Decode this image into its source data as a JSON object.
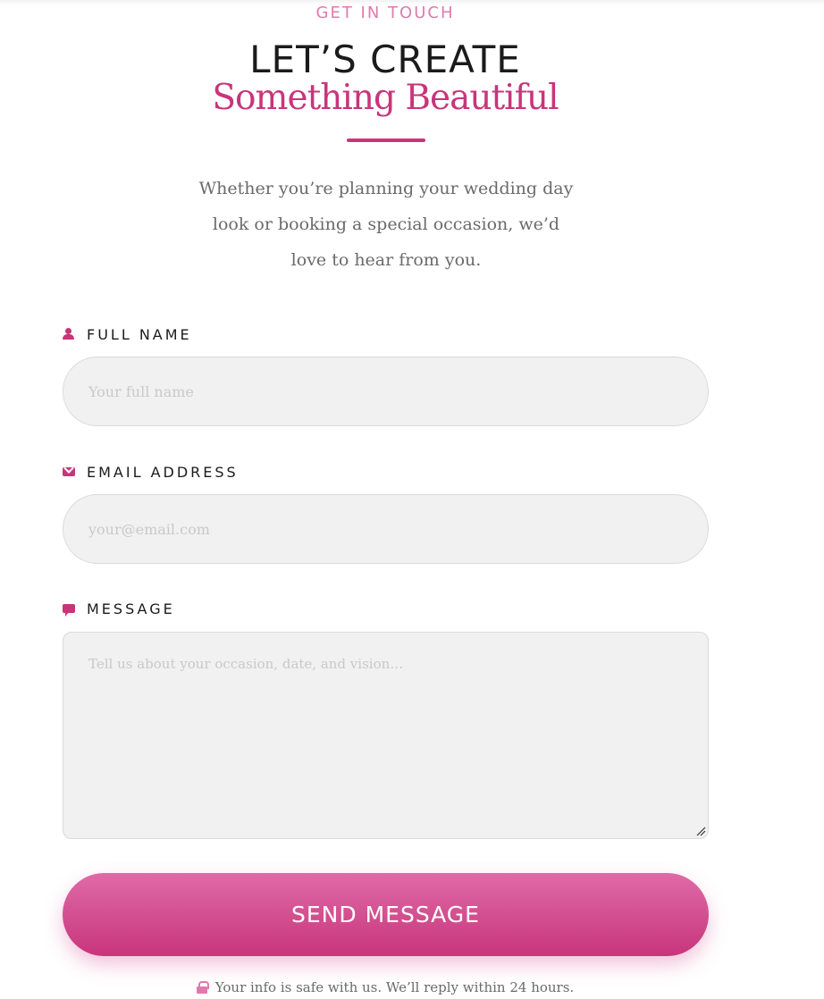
{
  "header": {
    "eyebrow": "GET IN TOUCH",
    "headline": "LET’S CREATE",
    "headline_script": "Something Beautiful",
    "intro": "Whether you’re planning your wedding day look or booking a special occasion, we’d love to hear from you."
  },
  "form": {
    "name": {
      "label": "FULL NAME",
      "icon": "user-icon",
      "value": "",
      "placeholder": "Your full name"
    },
    "email": {
      "label": "EMAIL ADDRESS",
      "icon": "envelope-icon",
      "value": "",
      "placeholder": "your@email.com"
    },
    "message": {
      "label": "MESSAGE",
      "icon": "comment-icon",
      "value": "",
      "placeholder": "Tell us about your occasion, date, and vision…"
    },
    "submit_label": "SEND MESSAGE",
    "privacy_note": "Your info is safe with us. We’ll reply within 24 hours.",
    "privacy_icon": "lock-icon"
  },
  "colors": {
    "accent": "#c8357b",
    "accent_light": "#e07aad",
    "field_bg": "#f1f1f1",
    "heading": "#1b1b1b",
    "body_text": "#6a6a6a"
  }
}
